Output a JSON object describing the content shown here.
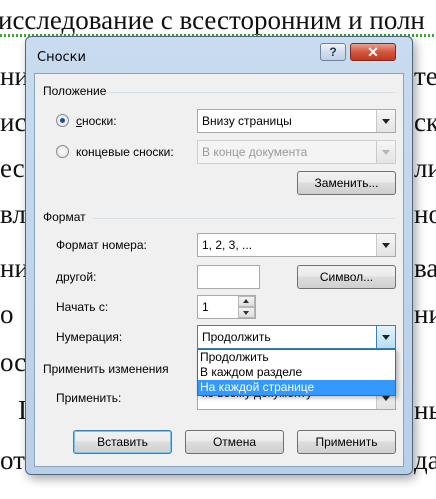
{
  "document": {
    "lines": [
      "исследование с всесторонним и полн",
      "ние",
      "исле",
      "ест",
      "вле",
      "ни и",
      "о",
      "оси",
      "I",
      "от"
    ],
    "right_fragments": [
      "те",
      "ска",
      "ли",
      "но",
      "ва",
      "ни",
      "ны",
      "дае"
    ]
  },
  "dialog": {
    "title": "Сноски",
    "help_label": "?",
    "close_label": "✕",
    "position": {
      "header": "Положение",
      "footnotes_label": "сноски:",
      "footnotes_value": "Внизу страницы",
      "endnotes_label": "концевые сноски:",
      "endnotes_value": "В конце документа",
      "replace_button": "Заменить..."
    },
    "format": {
      "header": "Формат",
      "number_format_label": "Формат номера:",
      "number_format_value": "1, 2, 3, ...",
      "custom_label": "другой:",
      "custom_value": "",
      "symbol_button": "Символ...",
      "start_at_label": "Начать с:",
      "start_at_value": "1",
      "numbering_label": "Нумерация:",
      "numbering_value": "Продолжить",
      "numbering_options": [
        "Продолжить",
        "В каждом разделе",
        "На каждой странице"
      ],
      "numbering_selected_index": 2
    },
    "apply_changes": {
      "header": "Применить изменения",
      "apply_label": "Применить:",
      "apply_value": "ко всему документу"
    },
    "buttons": {
      "insert": "Вставить",
      "cancel": "Отмена",
      "apply": "Применить"
    }
  },
  "colors": {
    "selection": "#3399ff",
    "frame": "#b9cfe8",
    "close": "#c03a23"
  }
}
